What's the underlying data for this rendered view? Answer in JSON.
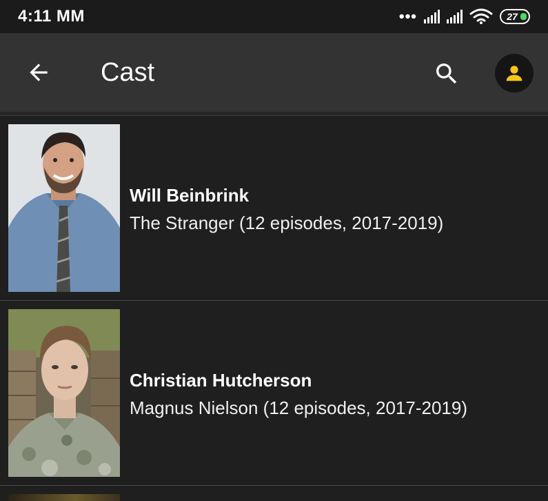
{
  "status_bar": {
    "time": "4:11 MM",
    "dots": "•••",
    "battery_level": "27"
  },
  "app_bar": {
    "title": "Cast",
    "back_icon": "arrow-left-icon",
    "search_icon": "search-icon",
    "account_icon": "person-icon",
    "accent_color": "#f5c518"
  },
  "cast": [
    {
      "name": "Will Beinbrink",
      "role": "The Stranger (12 episodes, 2017-2019)"
    },
    {
      "name": "Christian Hutcherson",
      "role": "Magnus Nielson (12 episodes, 2017-2019)"
    }
  ]
}
